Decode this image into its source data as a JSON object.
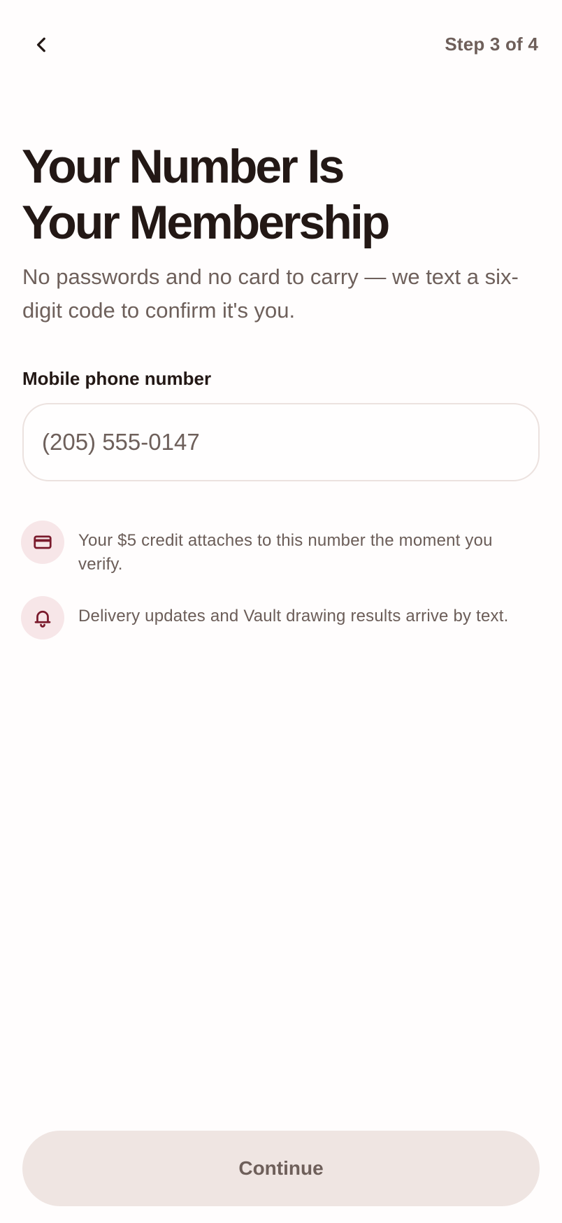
{
  "header": {
    "step": "Step 3 of 4",
    "back_icon": "chevron-left-icon"
  },
  "title": {
    "line1": "Your Number Is",
    "line2": "Your Membership"
  },
  "subtitle": "No passwords and no card to carry — we text a six-digit code to confirm it's you.",
  "phone": {
    "label": "Mobile phone number",
    "placeholder": "(205) 555-0147",
    "value": ""
  },
  "info": [
    {
      "icon": "credit-card-icon",
      "text": "Your $5 credit attaches to this number the moment you verify."
    },
    {
      "icon": "bell-icon",
      "text": "Delivery updates and Vault drawing results arrive by text."
    }
  ],
  "continue_label": "Continue",
  "colors": {
    "accent": "#7a1a2c",
    "icon_bg": "#f7e6e8",
    "button_bg": "#efe5e2",
    "text_dark": "#231815",
    "text_muted": "#6e605b"
  }
}
